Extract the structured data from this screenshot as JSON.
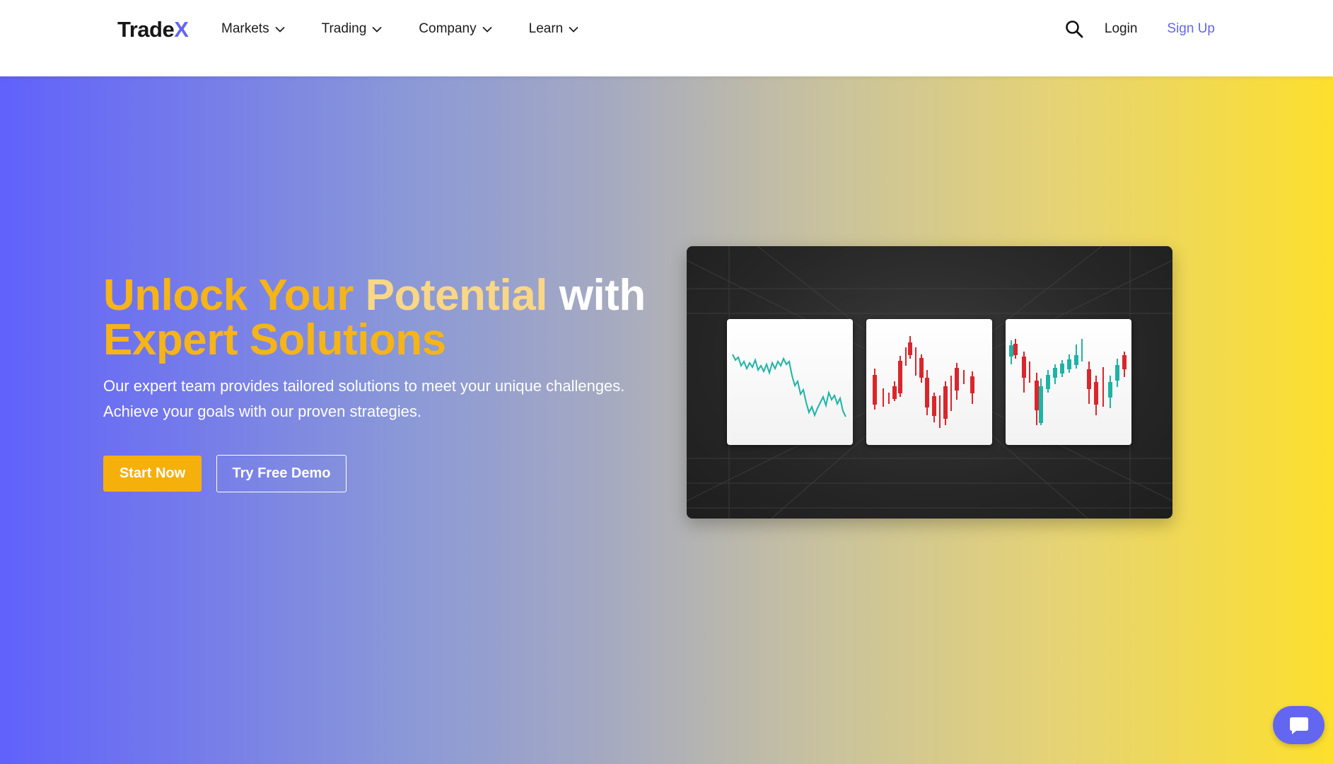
{
  "brand": {
    "name_part1": "Trade",
    "name_part2": "X",
    "accent": "#6366f1"
  },
  "nav": {
    "items": [
      {
        "label": "Markets",
        "icon": "chevron-down-icon"
      },
      {
        "label": "Trading",
        "icon": "chevron-down-icon"
      },
      {
        "label": "Company",
        "icon": "chevron-down-icon"
      },
      {
        "label": "Learn",
        "icon": "chevron-down-icon"
      }
    ],
    "search_icon": "search-icon",
    "login_label": "Login",
    "signup_label": "Sign Up"
  },
  "hero": {
    "headline_part1": "Unlock Your",
    "headline_part2": "Potential",
    "headline_part3": "with",
    "headline_part4": "Expert Solutions",
    "subtext_line1": "Our expert team provides tailored solutions to meet your unique challenges.",
    "subtext_line2": "Achieve your goals with our proven strategies.",
    "primary_cta": "Start Now",
    "secondary_cta": "Try Free Demo",
    "gradient_start": "#6161fb",
    "gradient_end": "#fddf2d",
    "primary_color": "#f5b00b"
  },
  "chart_preview": {
    "panels": [
      {
        "type": "line",
        "color": "#1fb3a6"
      },
      {
        "type": "candlestick",
        "color": "#d9262c"
      },
      {
        "type": "candlestick",
        "colors": [
          "#1fb3a6",
          "#d9262c"
        ]
      }
    ]
  },
  "chat": {
    "icon": "chat-bubble-icon",
    "color": "#6366f1"
  }
}
